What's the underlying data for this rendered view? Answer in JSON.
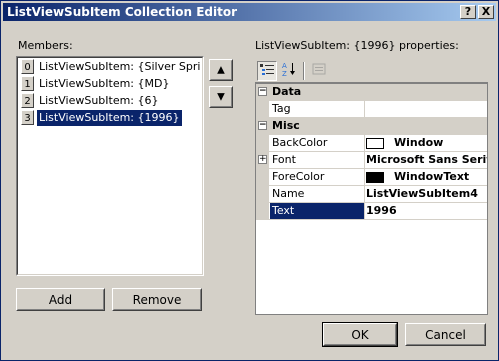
{
  "window": {
    "title": "ListViewSubItem Collection Editor"
  },
  "titlebar_buttons": {
    "help": "?",
    "close": "X"
  },
  "members": {
    "label": "Members:",
    "items": [
      {
        "index": "0",
        "text": "ListViewSubItem: {Silver Spring}",
        "selected": false
      },
      {
        "index": "1",
        "text": "ListViewSubItem: {MD}",
        "selected": false
      },
      {
        "index": "2",
        "text": "ListViewSubItem: {6}",
        "selected": false
      },
      {
        "index": "3",
        "text": "ListViewSubItem: {1996}",
        "selected": true
      }
    ],
    "move_up_icon": "▲",
    "move_down_icon": "▼"
  },
  "buttons": {
    "add": "Add",
    "remove": "Remove",
    "ok": "OK",
    "cancel": "Cancel"
  },
  "properties": {
    "label": "ListViewSubItem: {1996} properties:",
    "toolbar": {
      "categorized_icon": "categorized-icon",
      "alphabetical_icon": "alphabetical-icon",
      "property_pages_icon": "property-pages-icon"
    },
    "categories": [
      {
        "name": "Data",
        "rows": [
          {
            "name": "Tag",
            "value": ""
          }
        ]
      },
      {
        "name": "Misc",
        "rows": [
          {
            "name": "BackColor",
            "value": "Window",
            "swatch": "#ffffff"
          },
          {
            "name": "Font",
            "value": "Microsoft Sans Serif,",
            "expandable": true
          },
          {
            "name": "ForeColor",
            "value": "WindowText",
            "swatch": "#000000"
          },
          {
            "name": "Name",
            "value": "ListViewSubItem4"
          },
          {
            "name": "Text",
            "value": "1996",
            "selected": true
          }
        ]
      }
    ]
  },
  "colors": {
    "selection": "#0a246a",
    "face": "#d4d0c8"
  }
}
